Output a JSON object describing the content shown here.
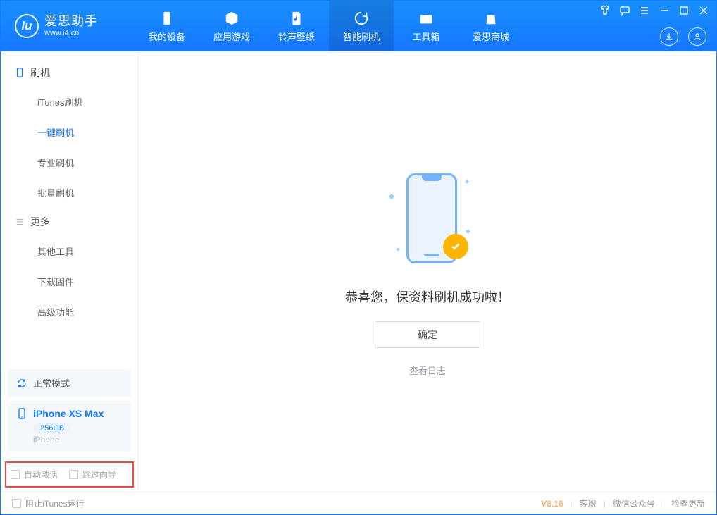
{
  "brand": {
    "name": "爱思助手",
    "subtitle": "www.i4.cn",
    "logo_glyph": "iu"
  },
  "nav": {
    "items": [
      {
        "label": "我的设备"
      },
      {
        "label": "应用游戏"
      },
      {
        "label": "铃声壁纸"
      },
      {
        "label": "智能刷机"
      },
      {
        "label": "工具箱"
      },
      {
        "label": "爱思商城"
      }
    ],
    "active_index": 3
  },
  "sidebar": {
    "groups": [
      {
        "title": "刷机",
        "items": [
          "iTunes刷机",
          "一键刷机",
          "专业刷机",
          "批量刷机"
        ],
        "active_index": 1
      },
      {
        "title": "更多",
        "items": [
          "其他工具",
          "下载固件",
          "高级功能"
        ],
        "active_index": -1
      }
    ],
    "mode_label": "正常模式",
    "device": {
      "name": "iPhone XS Max",
      "storage": "256GB",
      "type": "iPhone"
    },
    "options": {
      "auto_activate": "自动激活",
      "skip_guide": "跳过向导"
    }
  },
  "main": {
    "success_text": "恭喜您，保资料刷机成功啦！",
    "ok_label": "确定",
    "view_log": "查看日志"
  },
  "footer": {
    "block_itunes": "阻止iTunes运行",
    "version": "V8.16",
    "links": [
      "客服",
      "微信公众号",
      "检查更新"
    ]
  }
}
